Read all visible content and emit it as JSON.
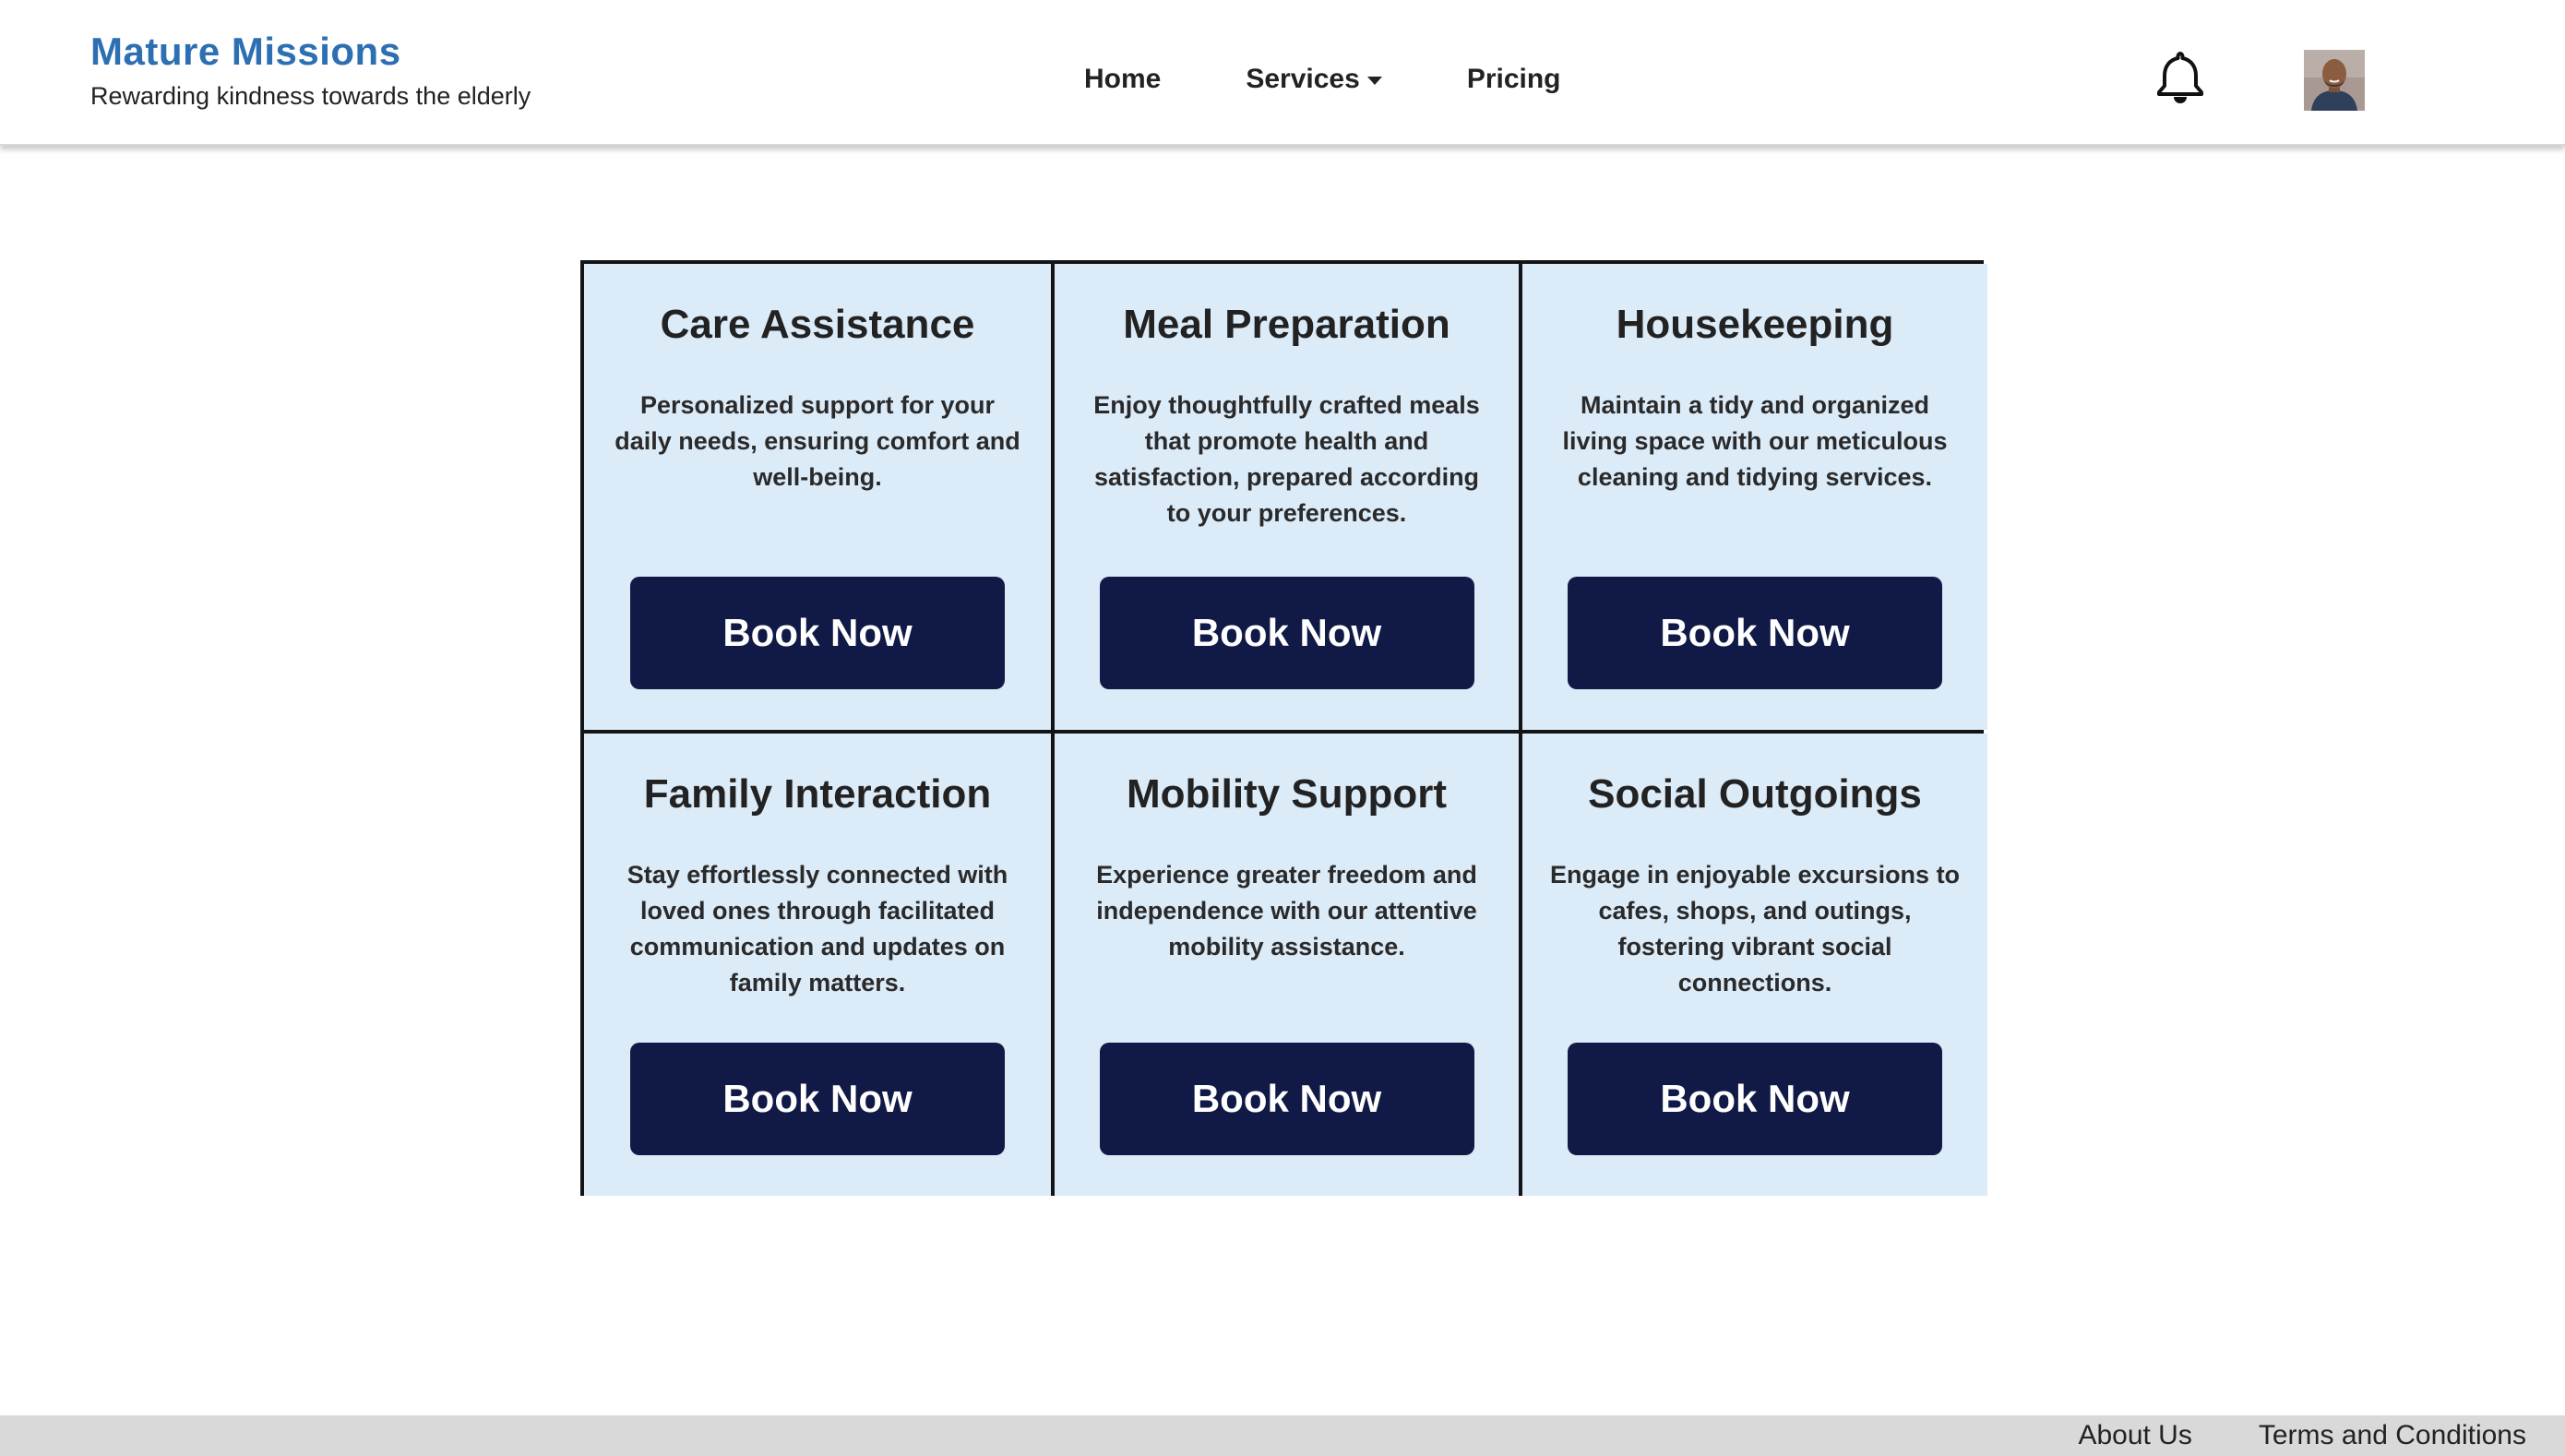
{
  "brand": {
    "title": "Mature Missions",
    "tagline": "Rewarding kindness towards the elderly",
    "color": "#2d6fb3"
  },
  "nav": {
    "items": [
      {
        "label": "Home"
      },
      {
        "label": "Services",
        "has_dropdown": true
      },
      {
        "label": "Pricing"
      }
    ]
  },
  "header_icons": {
    "notifications": "bell-icon",
    "profile": "avatar"
  },
  "services": [
    {
      "title": "Care Assistance",
      "description": "Personalized support for your daily needs, ensuring comfort and well-being.",
      "button": "Book Now"
    },
    {
      "title": "Meal Preparation",
      "description": "Enjoy thoughtfully crafted meals that promote health and satisfaction, prepared according to your preferences.",
      "button": "Book Now"
    },
    {
      "title": "Housekeeping",
      "description": "Maintain a tidy and organized living space with our meticulous cleaning and tidying services.",
      "button": "Book Now"
    },
    {
      "title": "Family Interaction",
      "description": "Stay effortlessly connected with loved ones through facilitated communication and updates on family matters.",
      "button": "Book Now"
    },
    {
      "title": "Mobility Support",
      "description": "Experience greater freedom and independence with our attentive mobility assistance.",
      "button": "Book Now"
    },
    {
      "title": "Social Outgoings",
      "description": "Engage in enjoyable excursions to cafes, shops, and outings, fostering vibrant social connections.",
      "button": "Book Now"
    }
  ],
  "footer": {
    "links": [
      {
        "label": "About Us"
      },
      {
        "label": "Terms and Conditions"
      }
    ]
  },
  "colors": {
    "card_background": "#dcebf8",
    "button_background": "#111a47",
    "footer_background": "#d9d9d9"
  }
}
